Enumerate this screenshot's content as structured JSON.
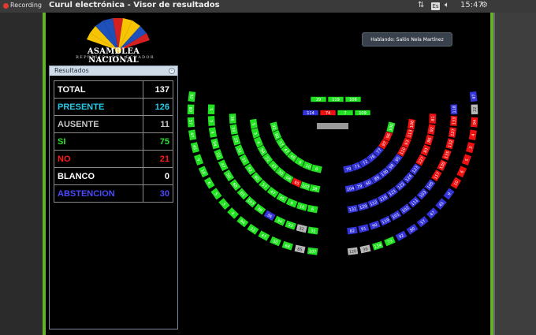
{
  "topbar": {
    "recording_label": "Recording",
    "window_title": "Curul electrónica - Visor de resultados",
    "keyboard_layout": "Es",
    "clock": "15:47"
  },
  "header": {
    "logo_title": "ASAMBLEA NACIONAL",
    "logo_subtitle": "REPÚBLICA DEL ECUADOR",
    "speaker_text": "Hablando: Salón Nela Martínez"
  },
  "results_panel": {
    "title": "Resultados",
    "rows": [
      {
        "label": "TOTAL",
        "value": "137",
        "color": "#ffffff"
      },
      {
        "label": "PRESENTE",
        "value": "126",
        "color": "#27c9e8"
      },
      {
        "label": "AUSENTE",
        "value": "11",
        "color": "#c8c8c8"
      },
      {
        "label": "SI",
        "value": "75",
        "color": "#2ee12e"
      },
      {
        "label": "NO",
        "value": "21",
        "color": "#ff1a1a"
      },
      {
        "label": "BLANCO",
        "value": "0",
        "color": "#ffffff"
      },
      {
        "label": "ABSTENCION",
        "value": "30",
        "color": "#4a4aff"
      }
    ]
  },
  "colors": {
    "si": "#22e022",
    "no": "#ee1111",
    "abstencion": "#3434d8",
    "ausente": "#b8b8b8",
    "frame": "#63b02a"
  },
  "presidium": {
    "top_row": [
      "29",
      "119",
      "106"
    ],
    "middle_row": [
      "114",
      "74",
      "7",
      "109"
    ]
  },
  "seats": [
    {
      "n": "92",
      "v": "si"
    },
    {
      "n": "80",
      "v": "si"
    },
    {
      "n": "57",
      "v": "si"
    },
    {
      "n": "47",
      "v": "si"
    },
    {
      "n": "45",
      "v": "si"
    },
    {
      "n": "9",
      "v": "si"
    },
    {
      "n": "10",
      "v": "si"
    },
    {
      "n": "6",
      "v": "si"
    },
    {
      "n": "5",
      "v": "si"
    },
    {
      "n": "3",
      "v": "si"
    },
    {
      "n": "4",
      "v": "si"
    },
    {
      "n": "94",
      "v": "no"
    },
    {
      "n": "22",
      "v": "abstencion"
    },
    {
      "n": "47",
      "v": "ausente"
    },
    {
      "n": "50",
      "v": "ausente"
    },
    {
      "n": "68",
      "v": "ausente"
    },
    {
      "n": "65",
      "v": "abstencion"
    },
    {
      "n": "107",
      "v": "si"
    },
    {
      "n": "38",
      "v": "si"
    },
    {
      "n": "36",
      "v": "si"
    },
    {
      "n": "34",
      "v": "si"
    },
    {
      "n": "33",
      "v": "si"
    },
    {
      "n": "32",
      "v": "si"
    },
    {
      "n": "31",
      "v": "si"
    },
    {
      "n": "70",
      "v": "abstencion"
    },
    {
      "n": "71",
      "v": "abstencion"
    },
    {
      "n": "72",
      "v": "abstencion"
    },
    {
      "n": "76",
      "v": "abstencion"
    },
    {
      "n": "77",
      "v": "abstencion"
    },
    {
      "n": "97",
      "v": "abstencion"
    },
    {
      "n": "96",
      "v": "abstencion"
    },
    {
      "n": "100",
      "v": "abstencion"
    },
    {
      "n": "104",
      "v": "abstencion"
    },
    {
      "n": "79",
      "v": "no"
    },
    {
      "n": "60",
      "v": "abstencion"
    },
    {
      "n": "89",
      "v": "abstencion"
    },
    {
      "n": "136",
      "v": "no"
    },
    {
      "n": "98",
      "v": "abstencion"
    },
    {
      "n": "95",
      "v": "abstencion"
    },
    {
      "n": "110",
      "v": "abstencion"
    },
    {
      "n": "93",
      "v": "abstencion"
    },
    {
      "n": "113",
      "v": "abstencion"
    },
    {
      "n": "108",
      "v": "abstencion"
    },
    {
      "n": "131",
      "v": "abstencion"
    },
    {
      "n": "129",
      "v": "abstencion"
    },
    {
      "n": "112",
      "v": "abstencion"
    },
    {
      "n": "116",
      "v": "ausente"
    },
    {
      "n": "121",
      "v": "ausente"
    },
    {
      "n": "122",
      "v": "ausente"
    },
    {
      "n": "124",
      "v": "si"
    },
    {
      "n": "123",
      "v": "si"
    },
    {
      "n": "127",
      "v": "si"
    },
    {
      "n": "83",
      "v": "abstencion"
    },
    {
      "n": "86",
      "v": "no"
    },
    {
      "n": "92",
      "v": "no"
    },
    {
      "n": "81",
      "v": "no"
    },
    {
      "n": "82",
      "v": "no"
    },
    {
      "n": "91",
      "v": "no"
    },
    {
      "n": "90",
      "v": "no"
    },
    {
      "n": "119",
      "v": "no"
    },
    {
      "n": "101",
      "v": "no"
    },
    {
      "n": "102",
      "v": "no"
    },
    {
      "n": "111",
      "v": "no"
    },
    {
      "n": "103",
      "v": "no"
    },
    {
      "n": "105",
      "v": "no"
    },
    {
      "n": "117",
      "v": "no"
    },
    {
      "n": "130",
      "v": "no"
    },
    {
      "n": "135",
      "v": "no"
    },
    {
      "n": "132",
      "v": "no"
    },
    {
      "n": "127",
      "v": "no"
    },
    {
      "n": "133",
      "v": "no"
    },
    {
      "n": "118",
      "v": "no"
    },
    {
      "n": "120",
      "v": "ausente"
    },
    {
      "n": "39",
      "v": "abstencion"
    },
    {
      "n": "134",
      "v": "abstencion"
    },
    {
      "n": "73",
      "v": "si"
    }
  ]
}
